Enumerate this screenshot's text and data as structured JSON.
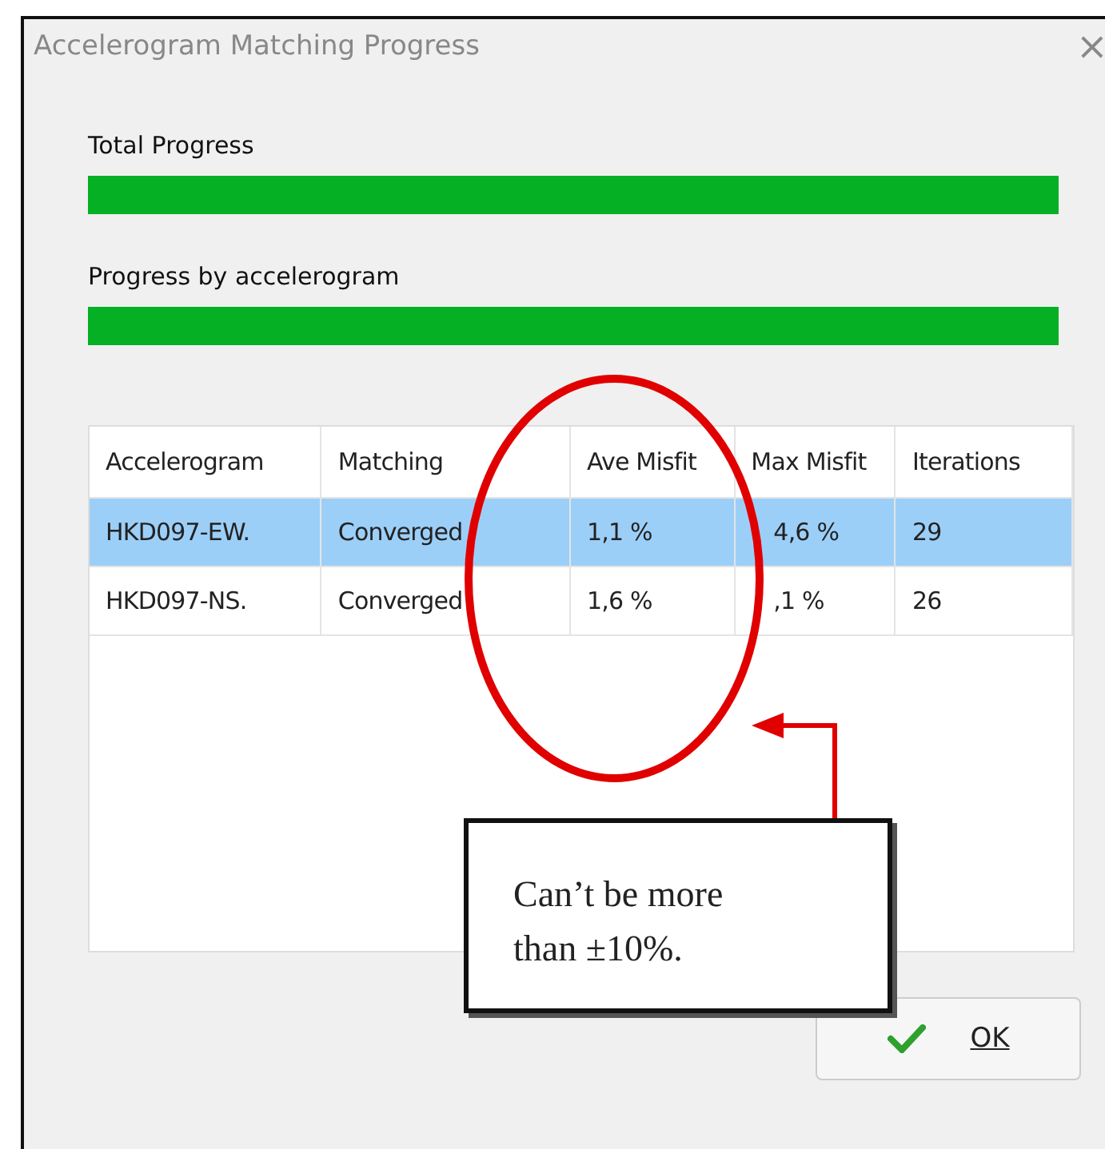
{
  "window": {
    "title": "Accelerogram Matching Progress",
    "close": "×"
  },
  "progress": [
    {
      "label": "Total Progress",
      "level": 1
    },
    {
      "label": "Progress by accelerogram",
      "level": 1
    }
  ],
  "table": {
    "columns": [
      "Accelerogram",
      "Matching",
      "Ave Misfit",
      "Max Misfit",
      "Iterations"
    ],
    "rows": [
      {
        "cells": [
          "HKD097-EW.",
          "Converged",
          "1,1 %",
          "4,6 %",
          "29"
        ],
        "selected": true
      },
      {
        "cells": [
          "HKD097-NS.",
          "Converged",
          "1,6 %",
          ",1 %",
          "26"
        ],
        "selected": false
      }
    ]
  },
  "callout": {
    "text": "Can’t be more than ±10%."
  },
  "buttons": [
    {
      "label": "OK"
    }
  ]
}
